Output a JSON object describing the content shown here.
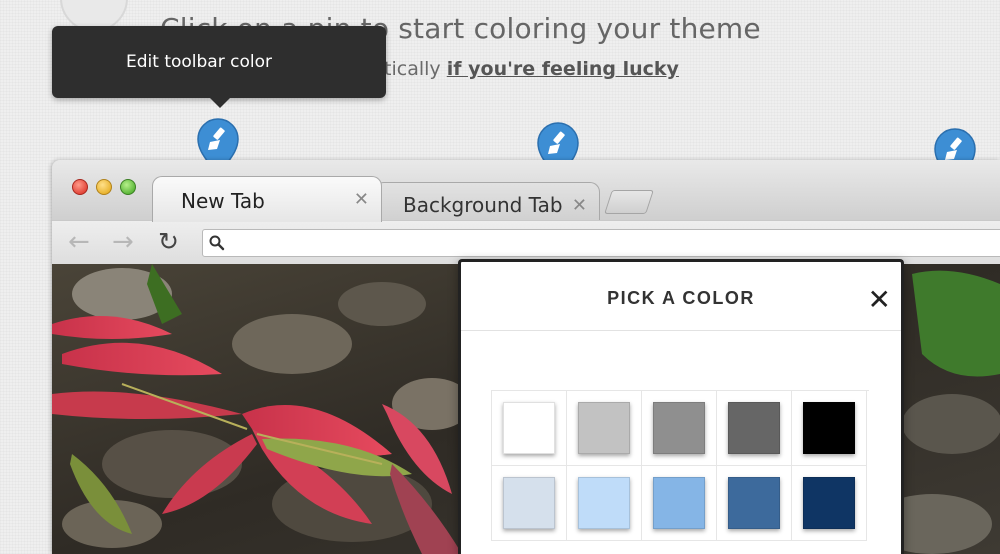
{
  "header": {
    "title": "Click on a pin to start coloring your theme",
    "subline_prefix": "...or pick colors automatically",
    "lucky_link": "if you're feeling lucky"
  },
  "tooltip": {
    "text": "Edit toolbar color"
  },
  "pins": [
    {
      "icon": "paintbrush-icon",
      "color": "#3d8ed4"
    },
    {
      "icon": "paintbrush-icon",
      "color": "#3d8ed4"
    },
    {
      "icon": "paintbrush-icon",
      "color": "#3d8ed4"
    }
  ],
  "browser": {
    "tabs": [
      {
        "label": "New Tab",
        "active": true
      },
      {
        "label": "Background Tab",
        "active": false
      }
    ],
    "close_glyph": "✕",
    "nav": {
      "back": "←",
      "forward": "→",
      "reload": "↻"
    }
  },
  "picker": {
    "title": "PICK A COLOR",
    "close_glyph": "✕",
    "swatches": [
      [
        "#ffffff",
        "#c2c2c2",
        "#8f8f8f",
        "#666666",
        "#000000"
      ],
      [
        "#d5e0ec",
        "#bfdcf9",
        "#85b5e6",
        "#3d6a9c",
        "#0f3564"
      ]
    ]
  }
}
